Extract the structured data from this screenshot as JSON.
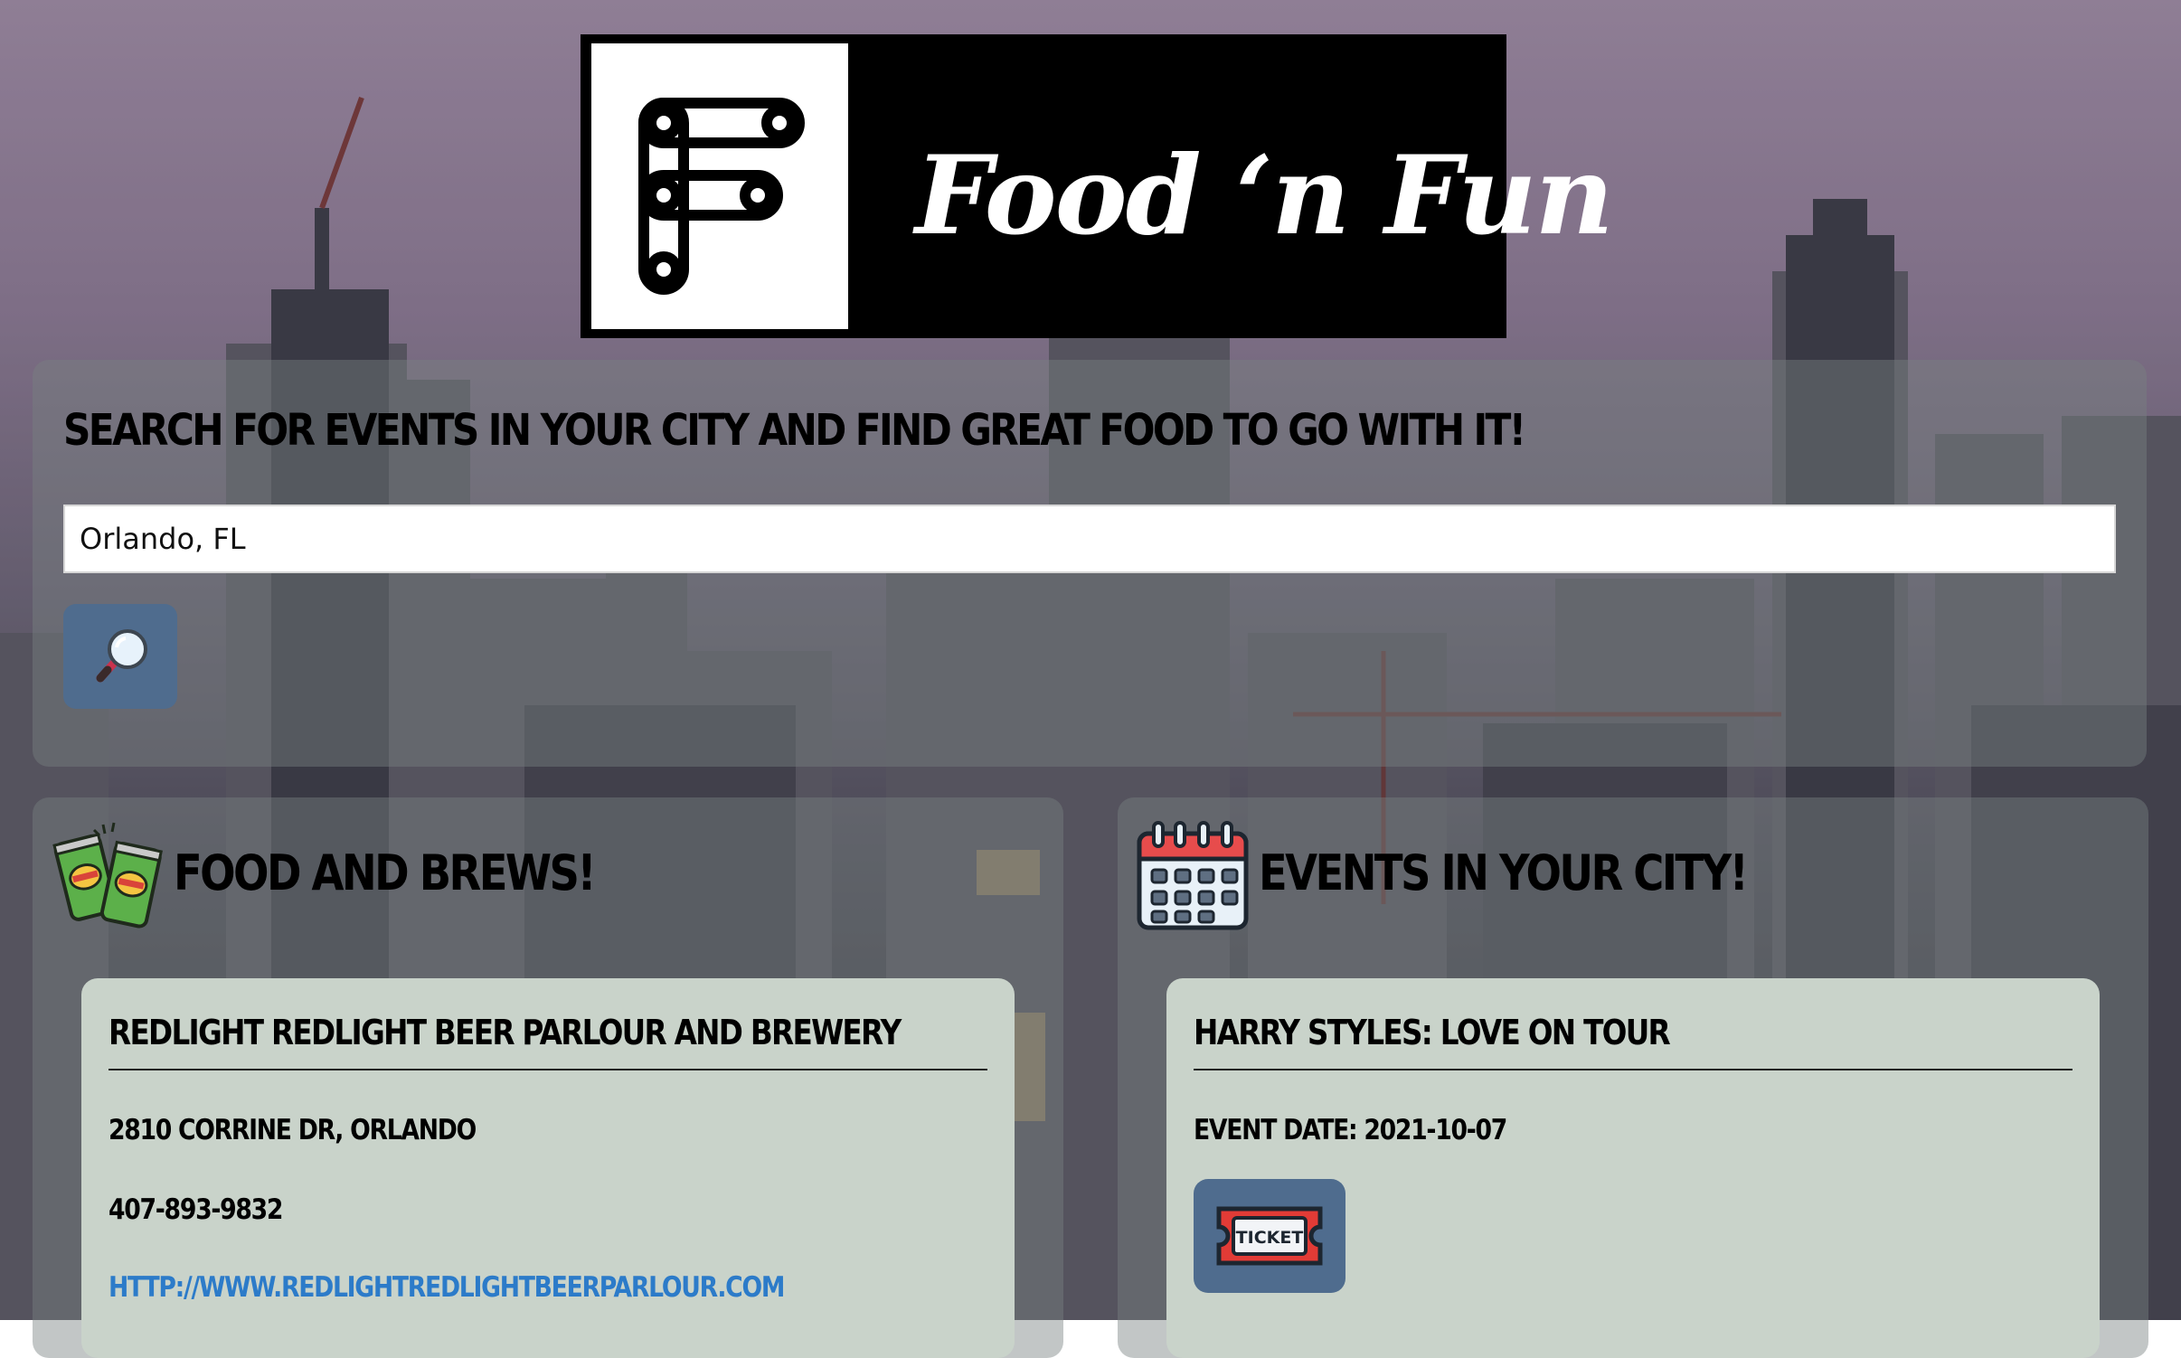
{
  "logo": {
    "text": "Food ‘n Fun"
  },
  "search": {
    "heading": "SEARCH FOR EVENTS IN YOUR CITY AND FIND GREAT FOOD TO GO WITH IT!",
    "input_value": "Orlando, FL",
    "button_icon": "magnifying-glass-icon"
  },
  "food": {
    "heading": "FOOD AND BREWS!",
    "icon": "beer-cans-icon",
    "card": {
      "name": "REDLIGHT REDLIGHT BEER PARLOUR AND BREWERY",
      "address": "2810 CORRINE DR, ORLANDO",
      "phone": "407-893-9832",
      "website": "HTTP://WWW.REDLIGHTREDLIGHTBEERPARLOUR.COM"
    }
  },
  "events": {
    "heading": "EVENTS IN YOUR CITY!",
    "icon": "calendar-icon",
    "card": {
      "name": "HARRY STYLES: LOVE ON TOUR",
      "date": "EVENT DATE: 2021-10-07",
      "ticket_icon": "ticket-icon",
      "ticket_label": "TICKET"
    }
  },
  "colors": {
    "panel": "#787f80",
    "card": "#c9d3ca",
    "button": "#4f6c8e",
    "link": "#2c7bc9"
  }
}
